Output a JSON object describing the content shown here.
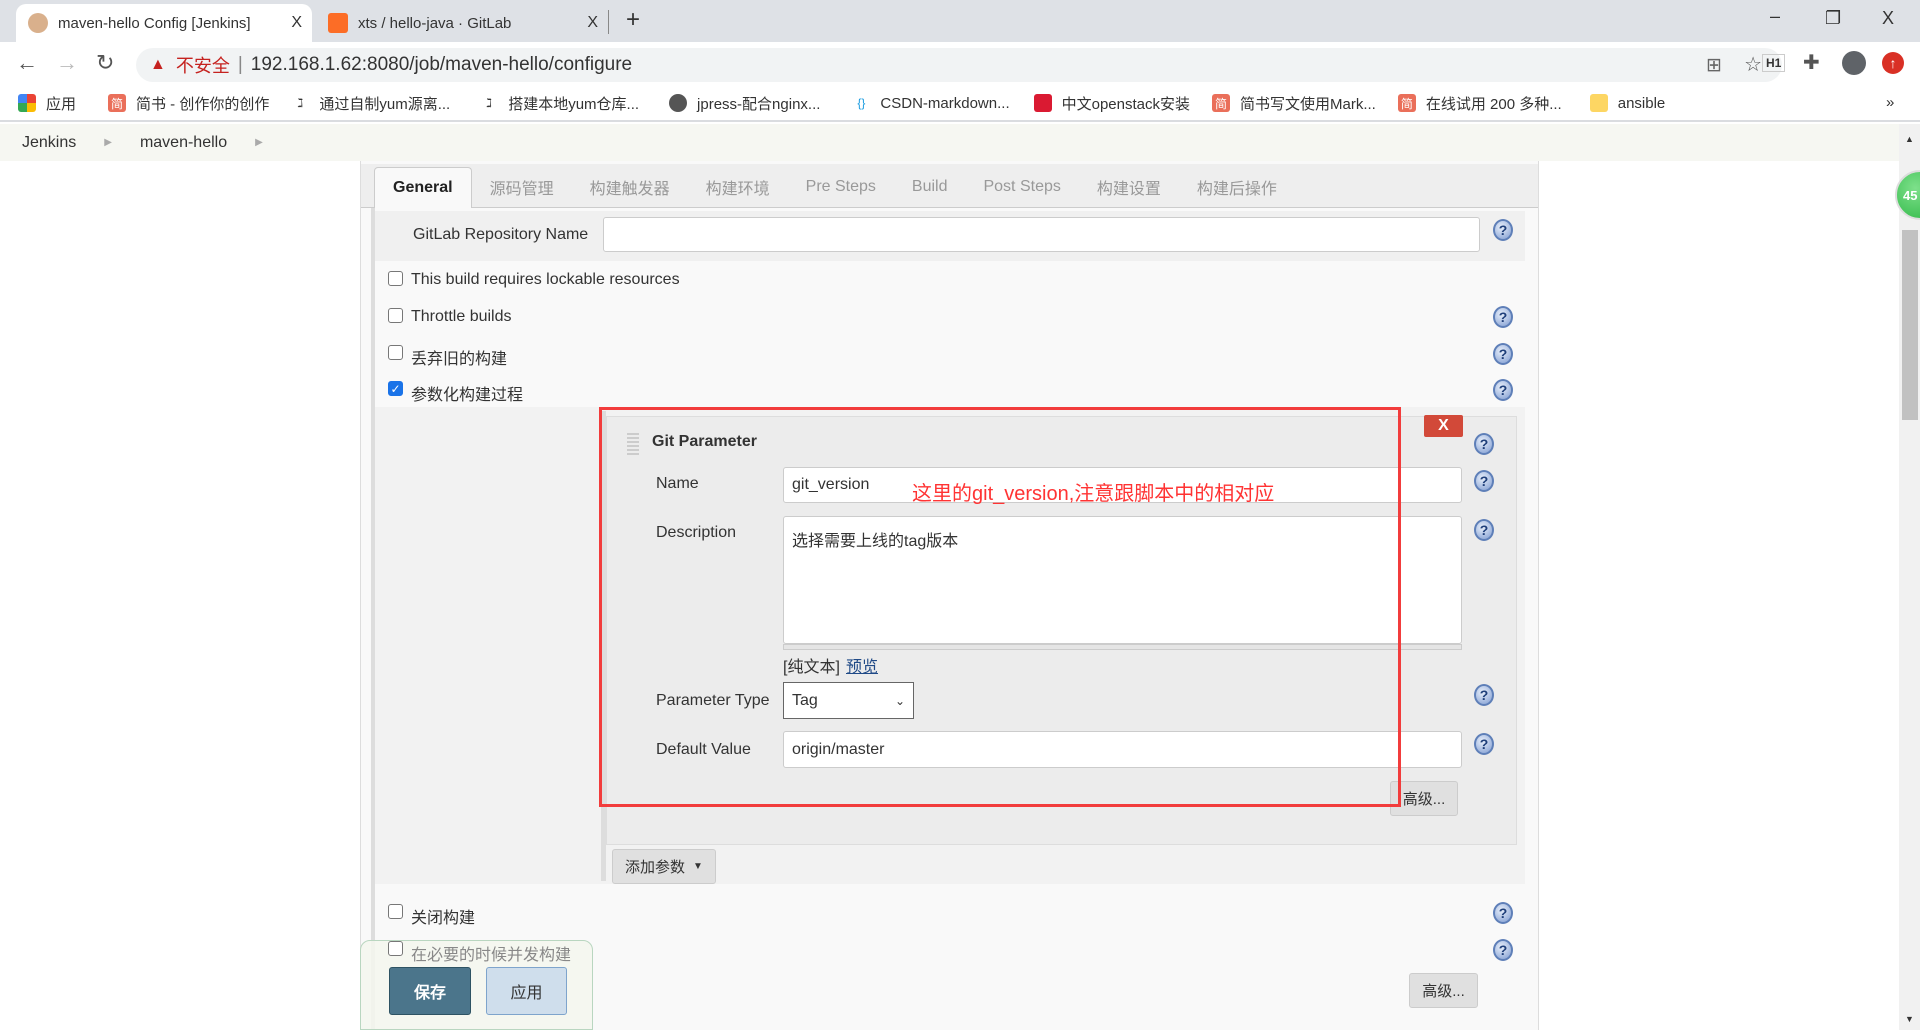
{
  "browser": {
    "tabs": [
      {
        "title": "maven-hello Config [Jenkins]",
        "close": "X"
      },
      {
        "title": "xts / hello-java · GitLab",
        "close": "X"
      }
    ],
    "new_tab": "+",
    "window_controls": {
      "minimize": "–",
      "restore": "❐",
      "close": "X"
    },
    "security_label": "不安全",
    "url": "192.168.1.62:8080/job/maven-hello/configure",
    "bookmarks": [
      {
        "label": "应用",
        "icon": "apps-grid-icon"
      },
      {
        "label": "简书 - 创作你的创作",
        "icon": "jianshu-icon",
        "color": "#ea6f5a"
      },
      {
        "label": "通过自制yum源离...",
        "icon": "bookmark-logo-icon"
      },
      {
        "label": "搭建本地yum仓库...",
        "icon": "bookmark-logo-icon"
      },
      {
        "label": "jpress-配合nginx...",
        "icon": "globe-icon"
      },
      {
        "label": "CSDN-markdown...",
        "icon": "csdn-icon"
      },
      {
        "label": "中文openstack安装",
        "icon": "openstack-icon",
        "color": "#da1a32"
      },
      {
        "label": "简书写文使用Mark...",
        "icon": "jianshu-icon",
        "color": "#ea6f5a"
      },
      {
        "label": "在线试用 200 多种...",
        "icon": "jianshu-icon",
        "color": "#ea6f5a"
      },
      {
        "label": "ansible",
        "icon": "folder-icon",
        "color": "#fdd663"
      }
    ],
    "more": "»",
    "toolbar_badge": "H1"
  },
  "breadcrumb": [
    "Jenkins",
    "maven-hello"
  ],
  "config": {
    "tabs": [
      "General",
      "源码管理",
      "构建触发器",
      "构建环境",
      "Pre Steps",
      "Build",
      "Post Steps",
      "构建设置",
      "构建后操作"
    ],
    "active_tab": "General",
    "gitlab_repo_label": "GitLab Repository Name",
    "gitlab_repo_value": "",
    "checkboxes": [
      {
        "label": "This build requires lockable resources",
        "checked": false
      },
      {
        "label": "Throttle builds",
        "checked": false
      },
      {
        "label": "丢弃旧的构建",
        "checked": false
      },
      {
        "label": "参数化构建过程",
        "checked": true
      }
    ],
    "git_parameter": {
      "title": "Git Parameter",
      "delete": "X",
      "name_label": "Name",
      "name_value": "git_version",
      "description_label": "Description",
      "description_value": "选择需要上线的tag版本",
      "plain_text": "[纯文本]",
      "preview": "预览",
      "type_label": "Parameter Type",
      "type_value": "Tag",
      "default_label": "Default Value",
      "default_value": "origin/master",
      "advanced": "高级..."
    },
    "add_param": "添加参数",
    "bottom_checkboxes": [
      {
        "label": "关闭构建",
        "checked": false
      },
      {
        "label": "在必要的时候并发构建",
        "checked": false
      }
    ],
    "advanced": "高级...",
    "save": "保存",
    "apply": "应用"
  },
  "annotation": {
    "text": "这里的git_version,注意跟脚本中的相对应",
    "color": "#ff3333"
  },
  "badge_number": "45"
}
